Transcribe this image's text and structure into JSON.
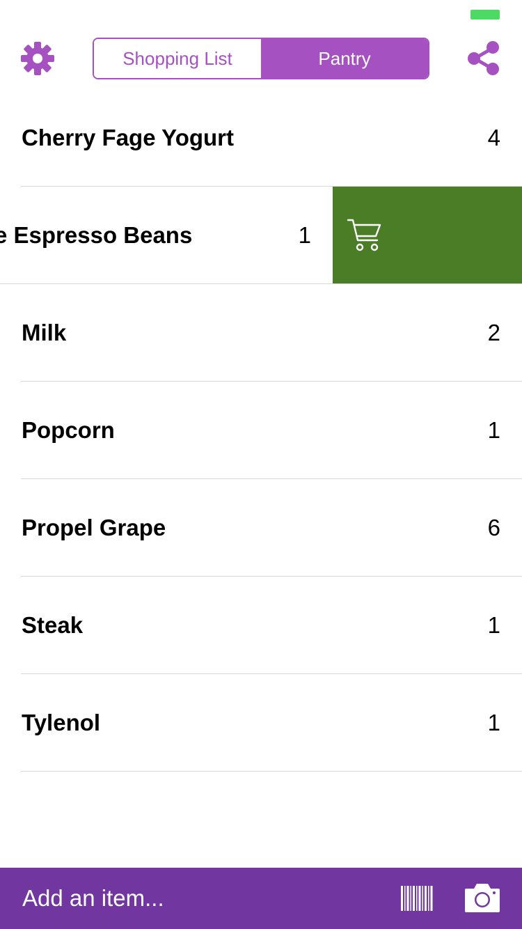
{
  "colors": {
    "accent": "#a651c2",
    "bottom_bar": "#7236a0",
    "swipe_action": "#4a7d25",
    "battery": "#4cd964"
  },
  "header": {
    "settings_icon": "gear-icon",
    "share_icon": "share-icon",
    "tabs": [
      {
        "label": "Shopping List",
        "selected": false
      },
      {
        "label": "Pantry",
        "selected": true
      }
    ]
  },
  "items": [
    {
      "name": "Cherry Fage Yogurt",
      "qty": "4"
    },
    {
      "name": "Whole Espresso Beans",
      "visible_name": "e Espresso Beans",
      "qty": "1",
      "swiped": true,
      "action_icon": "cart-icon"
    },
    {
      "name": "Milk",
      "qty": "2"
    },
    {
      "name": "Popcorn",
      "qty": "1"
    },
    {
      "name": "Propel Grape",
      "qty": "6"
    },
    {
      "name": "Steak",
      "qty": "1"
    },
    {
      "name": "Tylenol",
      "qty": "1"
    }
  ],
  "bottom_bar": {
    "placeholder": "Add an item...",
    "barcode_icon": "barcode-icon",
    "camera_icon": "camera-icon"
  }
}
